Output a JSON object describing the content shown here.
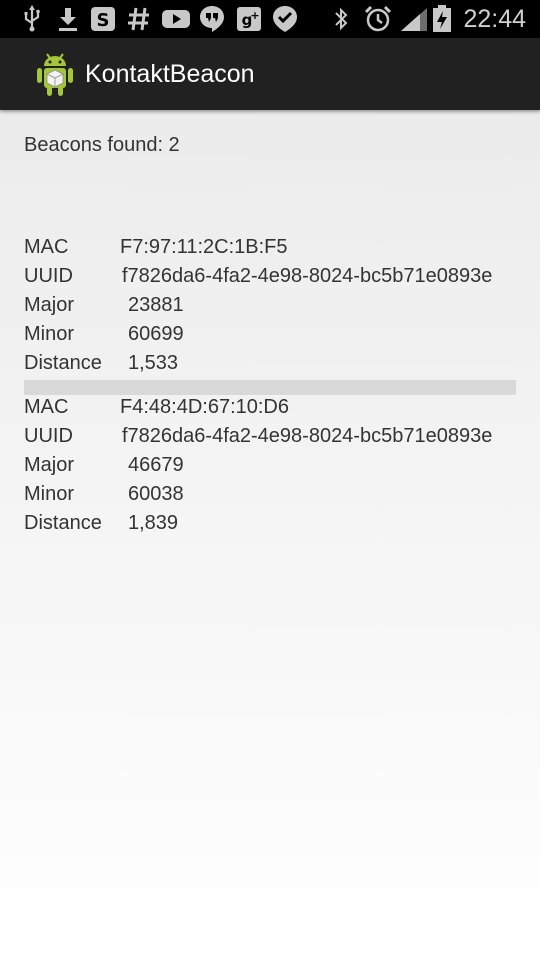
{
  "status_bar": {
    "time": "22:44",
    "icons": [
      "usb-icon",
      "download-icon",
      "s-box-icon",
      "hash-icon",
      "youtube-icon",
      "hangouts-icon",
      "google-plus-icon",
      "checkmark-icon",
      "bluetooth-icon",
      "alarm-icon",
      "signal-icon",
      "battery-charging-icon"
    ]
  },
  "action_bar": {
    "title": "KontaktBeacon",
    "icon": "android-app-icon"
  },
  "main": {
    "beacons_found": "Beacons found: 2",
    "beacons": [
      {
        "mac_label": "MAC",
        "mac": "F7:97:11:2C:1B:F5",
        "uuid_label": "UUID",
        "uuid": "f7826da6-4fa2-4e98-8024-bc5b71e0893e",
        "major_label": "Major",
        "major": "23881",
        "minor_label": "Minor",
        "minor": "60699",
        "distance_label": "Distance",
        "distance": "1,533"
      },
      {
        "mac_label": "MAC",
        "mac": "F4:48:4D:67:10:D6",
        "uuid_label": "UUID",
        "uuid": "f7826da6-4fa2-4e98-8024-bc5b71e0893e",
        "major_label": "Major",
        "major": "46679",
        "minor_label": "Minor",
        "minor": "60038",
        "distance_label": "Distance",
        "distance": "1,839"
      }
    ]
  },
  "colors": {
    "status_bar": "#000000",
    "action_bar": "#212121",
    "text": "#333333",
    "divider": "#d9d9d9",
    "android_green": "#a4c639"
  }
}
